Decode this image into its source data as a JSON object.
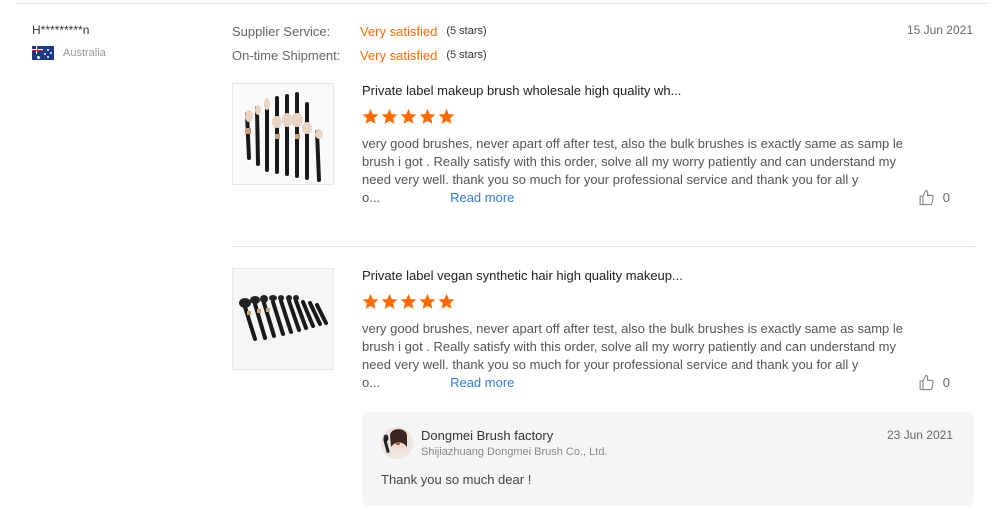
{
  "reviewer": {
    "name": "H*********n",
    "country": "Australia",
    "flag_icon": "australia-flag-icon"
  },
  "ratings": [
    {
      "label": "Supplier Service:",
      "value": "Very satisfied",
      "stars_text": "(5 stars)"
    },
    {
      "label": "On-time Shipment:",
      "value": "Very satisfied",
      "stars_text": "(5 stars)"
    }
  ],
  "review_date": "15 Jun 2021",
  "products": [
    {
      "title": "Private label makeup brush wholesale high quality wh...",
      "stars": 5,
      "text": "very good brushes, never apart off after test, also the bulk brushes is exactly same as samp le brush i got . Really satisfy with this order, solve all my worry patiently and can understand my need very well. thank you so much for your professional service and thank you for all y o...",
      "read_more": "Read more",
      "likes": "0"
    },
    {
      "title": "Private label vegan synthetic hair high quality makeup...",
      "stars": 5,
      "text": "very good brushes, never apart off after test, also the bulk brushes is exactly same as samp le brush i got . Really satisfy with this order, solve all my worry patiently and can understand my need very well. thank you so much for your professional service and thank you for all y o...",
      "read_more": "Read more",
      "likes": "0"
    }
  ],
  "reply": {
    "name": "Dongmei Brush factory",
    "company": "Shijiazhuang Dongmei Brush Co., Ltd.",
    "date": "23 Jun 2021",
    "text": "Thank you so much dear !"
  },
  "colors": {
    "accent": "#ff6a00",
    "link": "#2e7fd8",
    "star": "#ff6a00"
  }
}
